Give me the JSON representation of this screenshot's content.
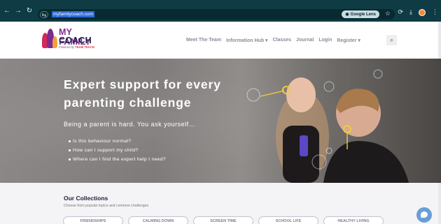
{
  "browser": {
    "url": "myfamilycoach.com",
    "lens_label": "Google Lens"
  },
  "header": {
    "logo": {
      "line1": "MY FAMILY",
      "line2": "COACH",
      "tagline_prefix": "Powered by",
      "tagline_brand": "TEAM TEACH"
    },
    "nav": [
      {
        "label": "Meet The Team"
      },
      {
        "label": "Information Hub ▾"
      },
      {
        "label": "Classes"
      },
      {
        "label": "Journal"
      },
      {
        "label": "Login"
      },
      {
        "label": "Register ▾"
      }
    ]
  },
  "hero": {
    "title": "Expert support for every parenting challenge",
    "lead": "Being a parent is hard. You ask yourself…",
    "questions": [
      "Is this behaviour normal?",
      "How can I support my child?",
      "Where can I find the expert help I need?"
    ]
  },
  "collections": {
    "title": "Our Collections",
    "subtitle": "Choose from popular topics and common challenges",
    "pills": [
      "FRIENDSHIPS",
      "CALMING DOWN",
      "SCREEN TIME",
      "SCHOOL LIFE",
      "HEALTHY LIVING"
    ]
  },
  "colors": {
    "chrome": "#0e3b44",
    "brand_purple": "#7e2b8f",
    "brand_navy": "#24214d",
    "chat": "#6a9dd8"
  }
}
